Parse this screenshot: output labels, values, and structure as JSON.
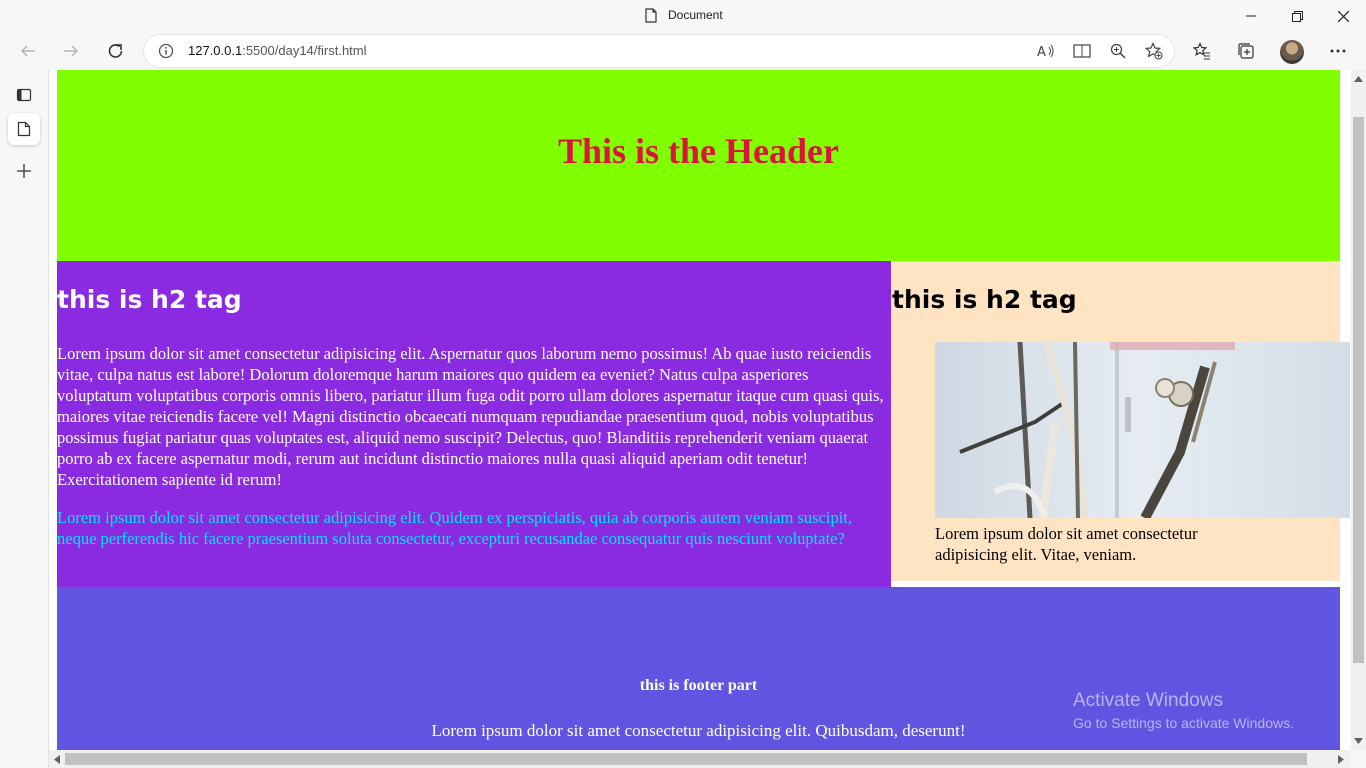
{
  "window": {
    "title": "Document"
  },
  "toolbar": {
    "url_host": "127.0.0.1",
    "url_rest": ":5500/day14/first.html"
  },
  "page": {
    "header_title": "This is the Header",
    "main": {
      "heading": "this is h2 tag",
      "paragraph1": "Lorem ipsum dolor sit amet consectetur adipisicing elit. Aspernatur quos laborum nemo possimus! Ab quae iusto reiciendis vitae, culpa natus est labore! Dolorum doloremque harum maiores quo quidem ea eveniet? Natus culpa asperiores voluptatum voluptatibus corporis omnis libero, pariatur illum fuga odit porro ullam dolores aspernatur itaque cum quasi quis, maiores vitae reiciendis facere vel! Magni distinctio obcaecati numquam repudiandae praesentium quod, nobis voluptatibus possimus fugiat pariatur quas voluptates est, aliquid nemo suscipit? Delectus, quo! Blanditiis reprehenderit veniam quaerat porro ab ex facere aspernatur modi, rerum aut incidunt distinctio maiores nulla quasi aliquid aperiam odit tenetur! Exercitationem sapiente id rerum!",
      "paragraph2": "Lorem ipsum dolor sit amet consectetur adipisicing elit. Quidem ex perspiciatis, quia ab corporis autem veniam suscipit, neque perferendis hic facere praesentium soluta consectetur, excepturi recusandae consequatur quis nesciunt voluptate?"
    },
    "aside": {
      "heading": "this is h2 tag",
      "caption": "Lorem ipsum dolor sit amet consectetur adipisicing elit. Vitae, veniam."
    },
    "footer": {
      "title": "this is footer part",
      "text": "Lorem ipsum dolor sit amet consectetur adipisicing elit. Quibusdam, deserunt!"
    }
  },
  "watermark": {
    "line1": "Activate Windows",
    "line2": "Go to Settings to activate Windows."
  },
  "colors": {
    "header_bg": "#80ff00",
    "header_text": "#dc143c",
    "main_bg": "#8a2be2",
    "aside_bg": "#ffe4c4",
    "footer_bg": "#6055e0",
    "paragraph2_text": "#00e5ff"
  },
  "icons": {
    "titlebar": [
      "document-icon",
      "minimize-icon",
      "restore-icon",
      "close-icon"
    ],
    "toolbar": [
      "back-icon",
      "forward-icon",
      "refresh-icon",
      "info-icon",
      "read-aloud-icon",
      "immersive-reader-icon",
      "zoom-icon",
      "add-favorite-icon",
      "favorites-icon",
      "collections-icon",
      "profile-avatar",
      "more-icon"
    ],
    "sidebar": [
      "tab-actions-icon",
      "page-icon",
      "add-icon"
    ]
  }
}
